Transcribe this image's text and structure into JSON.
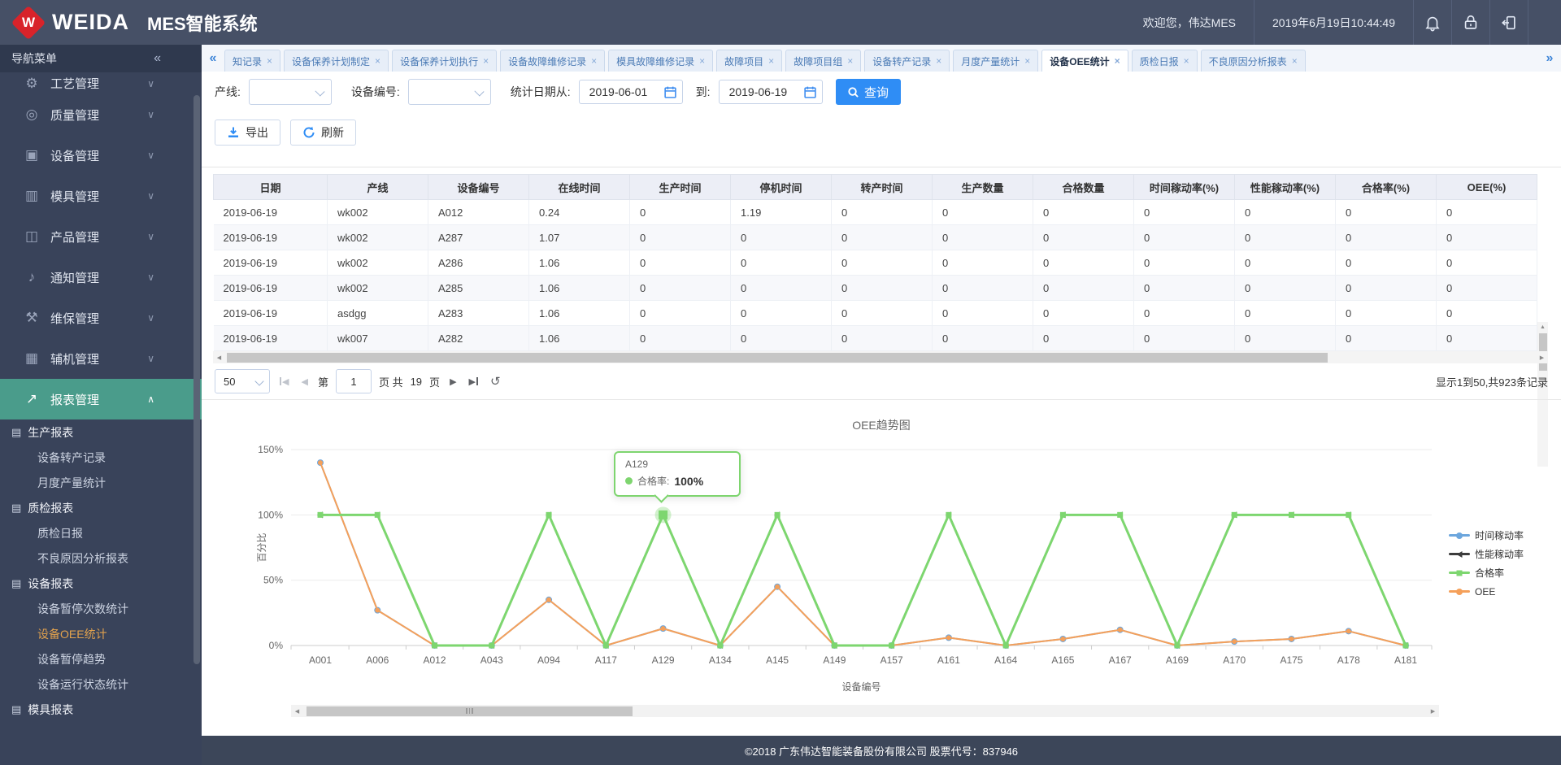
{
  "header": {
    "brand": "WEIDA",
    "app_title": "MES智能系统",
    "welcome": "欢迎您，伟达MES",
    "datetime": "2019年6月19日10:44:49"
  },
  "sidebar": {
    "title": "导航菜单",
    "collapse_glyph": "«",
    "chev_down": "∨",
    "chev_up": "∧",
    "items": [
      {
        "icon_name": "gear-icon",
        "glyph": "⚙",
        "label": "工艺管理",
        "clipped": true
      },
      {
        "icon_name": "quality-badge-icon",
        "glyph": "◎",
        "label": "质量管理"
      },
      {
        "icon_name": "monitor-icon",
        "glyph": "▣",
        "label": "设备管理"
      },
      {
        "icon_name": "mold-icon",
        "glyph": "▥",
        "label": "模具管理"
      },
      {
        "icon_name": "product-box-icon",
        "glyph": "◫",
        "label": "产品管理"
      },
      {
        "icon_name": "notice-bell-icon",
        "glyph": "♪",
        "label": "通知管理"
      },
      {
        "icon_name": "tools-icon",
        "glyph": "⚒",
        "label": "维保管理"
      },
      {
        "icon_name": "clipboard-icon",
        "glyph": "▦",
        "label": "辅机管理"
      },
      {
        "icon_name": "chart-icon",
        "glyph": "↗",
        "label": "报表管理",
        "active": true,
        "expanded": true
      }
    ],
    "groups": [
      {
        "icon_name": "report-list-icon",
        "glyph": "▤",
        "label": "生产报表",
        "children": [
          {
            "label": "设备转产记录"
          },
          {
            "label": "月度产量统计"
          }
        ]
      },
      {
        "icon_name": "report-list-icon",
        "glyph": "▤",
        "label": "质检报表",
        "children": [
          {
            "label": "质检日报"
          },
          {
            "label": "不良原因分析报表"
          }
        ]
      },
      {
        "icon_name": "report-list-icon",
        "glyph": "▤",
        "label": "设备报表",
        "children": [
          {
            "label": "设备暂停次数统计"
          },
          {
            "label": "设备OEE统计",
            "active": true
          },
          {
            "label": "设备暂停趋势"
          },
          {
            "label": "设备运行状态统计"
          }
        ]
      },
      {
        "icon_name": "report-list-icon",
        "glyph": "▤",
        "label": "模具报表",
        "children": []
      }
    ]
  },
  "tabs": {
    "left_scroll": "«",
    "right_scroll": "»",
    "close_glyph": "×",
    "items": [
      {
        "label": "知记录"
      },
      {
        "label": "设备保养计划制定"
      },
      {
        "label": "设备保养计划执行"
      },
      {
        "label": "设备故障维修记录"
      },
      {
        "label": "模具故障维修记录"
      },
      {
        "label": "故障项目"
      },
      {
        "label": "故障项目组"
      },
      {
        "label": "设备转产记录"
      },
      {
        "label": "月度产量统计"
      },
      {
        "label": "设备OEE统计",
        "active": true
      },
      {
        "label": "质检日报"
      },
      {
        "label": "不良原因分析报表"
      }
    ]
  },
  "filters": {
    "line_label": "产线:",
    "device_label": "设备编号:",
    "from_label": "统计日期从:",
    "to_label": "到:",
    "from_value": "2019-06-01",
    "to_value": "2019-06-19",
    "search_label": "查询"
  },
  "toolbar": {
    "export_label": "导出",
    "refresh_label": "刷新"
  },
  "table": {
    "columns": [
      "日期",
      "产线",
      "设备编号",
      "在线时间",
      "生产时间",
      "停机时间",
      "转产时间",
      "生产数量",
      "合格数量",
      "时间稼动率(%)",
      "性能稼动率(%)",
      "合格率(%)",
      "OEE(%)"
    ],
    "rows": [
      [
        "2019-06-19",
        "wk002",
        "A012",
        "0.24",
        "0",
        "1.19",
        "0",
        "0",
        "0",
        "0",
        "0",
        "0",
        "0"
      ],
      [
        "2019-06-19",
        "wk002",
        "A287",
        "1.07",
        "0",
        "0",
        "0",
        "0",
        "0",
        "0",
        "0",
        "0",
        "0"
      ],
      [
        "2019-06-19",
        "wk002",
        "A286",
        "1.06",
        "0",
        "0",
        "0",
        "0",
        "0",
        "0",
        "0",
        "0",
        "0"
      ],
      [
        "2019-06-19",
        "wk002",
        "A285",
        "1.06",
        "0",
        "0",
        "0",
        "0",
        "0",
        "0",
        "0",
        "0",
        "0"
      ],
      [
        "2019-06-19",
        "asdgg",
        "A283",
        "1.06",
        "0",
        "0",
        "0",
        "0",
        "0",
        "0",
        "0",
        "0",
        "0"
      ],
      [
        "2019-06-19",
        "wk007",
        "A282",
        "1.06",
        "0",
        "0",
        "0",
        "0",
        "0",
        "0",
        "0",
        "0",
        "0"
      ]
    ]
  },
  "pager": {
    "size": "50",
    "prefix": "第",
    "value": "1",
    "middle": "页 共",
    "total": "19",
    "suffix": "页",
    "info": "显示1到50,共923条记录"
  },
  "chart_data": {
    "type": "line",
    "title": "OEE趋势图",
    "xlabel": "设备编号",
    "ylabel": "百分比",
    "ylim": [
      0,
      150
    ],
    "y_ticks": [
      "0%",
      "50%",
      "100%",
      "150%"
    ],
    "grid": true,
    "legend_position": "right",
    "categories": [
      "A001",
      "A006",
      "A012",
      "A043",
      "A094",
      "A117",
      "A129",
      "A134",
      "A145",
      "A149",
      "A157",
      "A161",
      "A164",
      "A165",
      "A167",
      "A169",
      "A170",
      "A175",
      "A178",
      "A181"
    ],
    "series": [
      {
        "name": "时间稼动率",
        "color": "#6ca6dd",
        "marker": "circle",
        "values": [
          140,
          27,
          0,
          0,
          35,
          0,
          13,
          0,
          45,
          0,
          0,
          6,
          0,
          5,
          12,
          0,
          3,
          5,
          11,
          0
        ]
      },
      {
        "name": "性能稼动率",
        "color": "#3c3c3c",
        "marker": "triangle",
        "values": [
          100,
          100,
          0,
          0,
          100,
          0,
          100,
          0,
          100,
          0,
          0,
          100,
          0,
          100,
          100,
          0,
          100,
          100,
          100,
          0
        ]
      },
      {
        "name": "合格率",
        "color": "#7dd66f",
        "marker": "rect",
        "values": [
          100,
          100,
          0,
          0,
          100,
          0,
          100,
          0,
          100,
          0,
          0,
          100,
          0,
          100,
          100,
          0,
          100,
          100,
          100,
          0
        ]
      },
      {
        "name": "OEE",
        "color": "#f5a05a",
        "marker": "circle",
        "values": [
          140,
          27,
          0,
          0,
          35,
          0,
          13,
          0,
          45,
          0,
          0,
          6,
          0,
          5,
          12,
          0,
          3,
          5,
          11,
          0
        ]
      }
    ],
    "draw_order": [
      1,
      0,
      3,
      2
    ],
    "emphasis": {
      "series_index": 2,
      "point_index": 6
    }
  },
  "tooltip": {
    "title": "A129",
    "series": "合格率:",
    "value": "100%"
  },
  "footer": {
    "text": "©2018 广东伟达智能装备股份有限公司 股票代号：837946"
  }
}
